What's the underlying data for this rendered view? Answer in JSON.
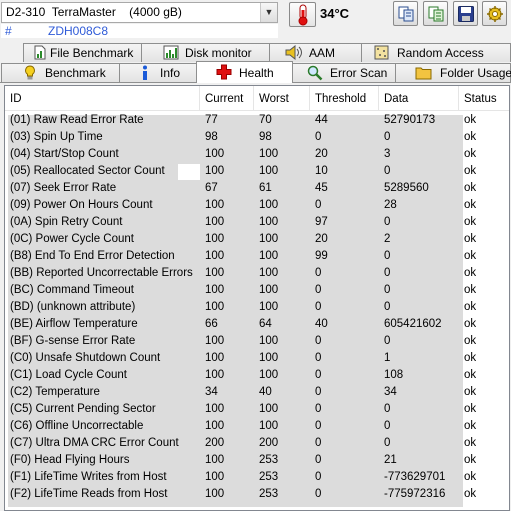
{
  "toolbar": {
    "drive_model": "D2-310  TerraMaster",
    "drive_capacity": "(4000 gB)",
    "temperature": "34°C",
    "dropdown_arrow": "▼",
    "buttons": [
      "copy-icon",
      "copy-all-icon",
      "save-icon",
      "options-icon"
    ]
  },
  "serial": {
    "hash": "#",
    "value": "ZDH008C8"
  },
  "tabs_top": [
    {
      "label": "File Benchmark",
      "icon": "file-benchmark-icon"
    },
    {
      "label": "Disk monitor",
      "icon": "disk-monitor-icon"
    },
    {
      "label": "AAM",
      "icon": "speaker-icon"
    },
    {
      "label": "Random Access",
      "icon": "random-access-icon"
    }
  ],
  "tabs_bottom": [
    {
      "label": "Benchmark",
      "icon": "bulb-icon"
    },
    {
      "label": "Info",
      "icon": "info-icon"
    },
    {
      "label": "Health",
      "icon": "health-cross-icon",
      "active": true
    },
    {
      "label": "Error Scan",
      "icon": "magnifier-icon"
    },
    {
      "label": "Folder Usage",
      "icon": "folder-icon"
    }
  ],
  "table": {
    "columns": [
      "ID",
      "Current",
      "Worst",
      "Threshold",
      "Data",
      "Status"
    ],
    "rows": [
      [
        "(01) Raw Read Error Rate",
        "77",
        "70",
        "44",
        "52790173",
        "ok"
      ],
      [
        "(03) Spin Up Time",
        "98",
        "98",
        "0",
        "0",
        "ok"
      ],
      [
        "(04) Start/Stop Count",
        "100",
        "100",
        "20",
        "3",
        "ok"
      ],
      [
        "(05) Reallocated Sector Count",
        "100",
        "100",
        "10",
        "0",
        "ok"
      ],
      [
        "(07) Seek Error Rate",
        "67",
        "61",
        "45",
        "5289560",
        "ok"
      ],
      [
        "(09) Power On Hours Count",
        "100",
        "100",
        "0",
        "28",
        "ok"
      ],
      [
        "(0A) Spin Retry Count",
        "100",
        "100",
        "97",
        "0",
        "ok"
      ],
      [
        "(0C) Power Cycle Count",
        "100",
        "100",
        "20",
        "2",
        "ok"
      ],
      [
        "(B8) End To End Error Detection",
        "100",
        "100",
        "99",
        "0",
        "ok"
      ],
      [
        "(BB) Reported Uncorrectable Errors",
        "100",
        "100",
        "0",
        "0",
        "ok"
      ],
      [
        "(BC) Command Timeout",
        "100",
        "100",
        "0",
        "0",
        "ok"
      ],
      [
        "(BD) (unknown attribute)",
        "100",
        "100",
        "0",
        "0",
        "ok"
      ],
      [
        "(BE) Airflow Temperature",
        "66",
        "64",
        "40",
        "605421602",
        "ok"
      ],
      [
        "(BF) G-sense Error Rate",
        "100",
        "100",
        "0",
        "0",
        "ok"
      ],
      [
        "(C0) Unsafe Shutdown Count",
        "100",
        "100",
        "0",
        "1",
        "ok"
      ],
      [
        "(C1) Load Cycle Count",
        "100",
        "100",
        "0",
        "108",
        "ok"
      ],
      [
        "(C2) Temperature",
        "34",
        "40",
        "0",
        "34",
        "ok"
      ],
      [
        "(C5) Current Pending Sector",
        "100",
        "100",
        "0",
        "0",
        "ok"
      ],
      [
        "(C6) Offline Uncorrectable",
        "100",
        "100",
        "0",
        "0",
        "ok"
      ],
      [
        "(C7) Ultra DMA CRC Error Count",
        "200",
        "200",
        "0",
        "0",
        "ok"
      ],
      [
        "(F0) Head Flying Hours",
        "100",
        "253",
        "0",
        "21",
        "ok"
      ],
      [
        "(F1) LifeTime Writes from Host",
        "100",
        "253",
        "0",
        "-773629701",
        "ok"
      ],
      [
        "(F2) LifeTime Reads from Host",
        "100",
        "253",
        "0",
        "-775972316",
        "ok"
      ]
    ]
  },
  "colors": {
    "serial_text": "#2f5bd8",
    "shade": "#dcdcdc",
    "health_red": "#e01010"
  }
}
